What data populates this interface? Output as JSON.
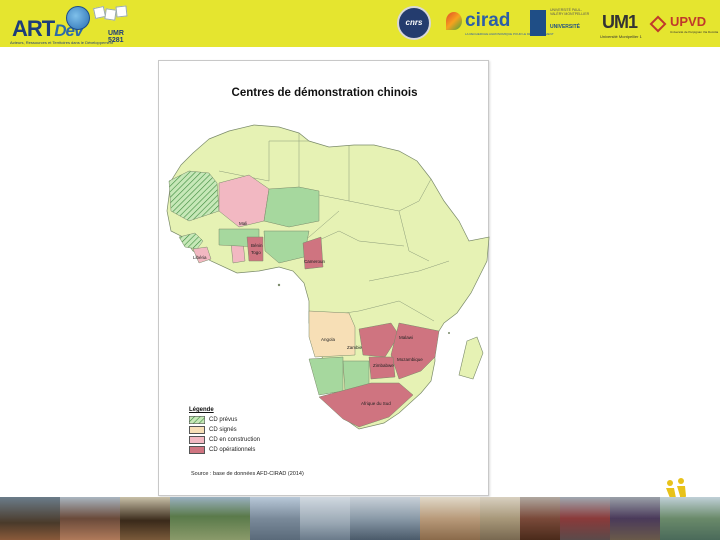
{
  "header": {
    "logo_main": "ART",
    "logo_dev": "Dev",
    "logo_umr": "UMR 5281",
    "logo_subtitle": "Acteurs, Ressources et Territoires dans le Développement",
    "partners": {
      "cnrs": "cnrs",
      "cirad": "cirad",
      "cirad_sub": "LA RECHERCHE AGRONOMIQUE POUR LE DÉVELOPPEMENT",
      "upv_lines": "UNIVERSITÉ PAUL-VALÉRY MONTPELLIER",
      "upv_name": "UNIVERSITÉ",
      "um1": "UM1",
      "um1_sub": "Université Montpellier 1",
      "upvd": "UPVD",
      "upvd_sub": "Université de Perpignan Via Domitia"
    },
    "background_color": "#e5e52f"
  },
  "map": {
    "title": "Centres de démonstration chinois",
    "country_labels": {
      "mali": "Mali",
      "cameroun": "Cameroun",
      "angola": "Angola",
      "zambie": "Zambie",
      "malawi": "Malawi",
      "mozambique": "Mozambique",
      "zimbabwe": "Zimbabwe",
      "afrique_du_sud": "Afrique du Sud",
      "liberia": "Libéria",
      "benin": "Bénin",
      "togo": "Togo"
    },
    "legend": {
      "title": "Légende",
      "items": [
        {
          "label": "CD prévus",
          "color": "#9cd69a",
          "pattern": "hatch"
        },
        {
          "label": "CD signés",
          "color": "#f7dfb6",
          "pattern": "solid"
        },
        {
          "label": "CD en construction",
          "color": "#f2b8c2",
          "pattern": "solid"
        },
        {
          "label": "CD opérationnels",
          "color": "#cf7480",
          "pattern": "solid"
        }
      ]
    },
    "source": "Source : base de données AFD-CIRAD (2014)",
    "colors": {
      "base": "#e6f2b4",
      "prevus": "#a6d89e",
      "signes": "#f7dfb6",
      "construction": "#f2b8c2",
      "operationnels": "#cf7480"
    }
  }
}
